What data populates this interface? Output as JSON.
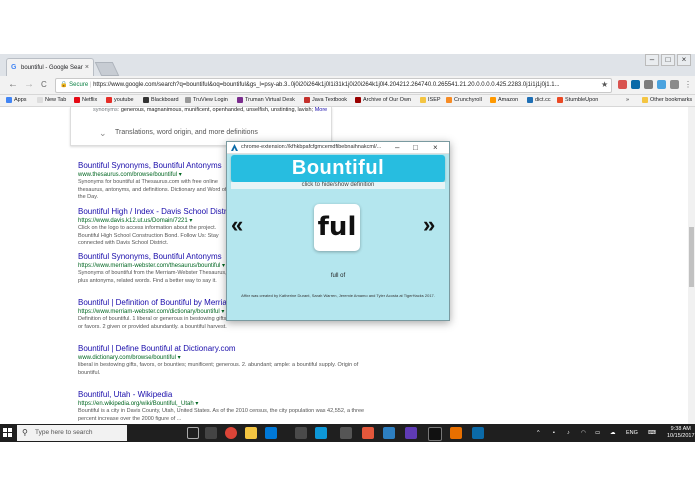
{
  "browser": {
    "tab_title": "bountiful - Google Sear",
    "tab_close": "×",
    "tab_favicon": "G",
    "nav_back": "←",
    "nav_forward": "→",
    "nav_reload": "C",
    "secure_label": "Secure",
    "url": "https://www.google.com/search?q=bountiful&oq=bountiful&gs_l=psy-ab.3..0j0i20i264k1j0l1i31k1j0i20i264k1j0l4.204212.264740.0.265541.21.20.0.0.0.0.425.2283.0j1i1j1j0j1.1...",
    "star": "★",
    "window_minimize": "–",
    "window_maximize": "□",
    "window_close": "×"
  },
  "bookmarks": {
    "items": [
      "Apps",
      "New Tab",
      "Netflix",
      "youtube",
      "Blackboard",
      "TruView Login",
      "Truman Virtual Desk",
      "Java Textbook",
      "Archive of Our Own",
      "ISEP",
      "Crunchyroll",
      "Amazon",
      "dict.cc",
      "StumbleUpon"
    ],
    "overflow": "»",
    "other": "Other bookmarks"
  },
  "knowledge_panel": {
    "synonyms_prefix": "synonyms:",
    "synonyms": "generous, magnanimous, munificent, openhanded, unselfish, unstinting, lavish;",
    "more": "More",
    "expand_icon": "⌄",
    "translations": "Translations, word origin, and more definitions"
  },
  "results": [
    {
      "title": "Bountiful Synonyms, Bountiful Antonyms",
      "url": "www.thesaurus.com/browse/bountiful ▾",
      "desc": "Synonyms for bountiful at Thesaurus.com with free online thesaurus, antonyms, and definitions. Dictionary and Word of the Day."
    },
    {
      "title": "Bountiful High / Index - Davis School District",
      "url": "https://www.davis.k12.ut.us/Domain/7221 ▾",
      "desc": "Click on the logo to access information about the project. Bountiful High School Construction Bond. Follow Us: Stay connected with Davis School District."
    },
    {
      "title": "Bountiful Synonyms, Bountiful Antonyms",
      "url": "https://www.merriam-webster.com/thesaurus/bountiful ▾",
      "desc": "Synonyms of bountiful from the Merriam-Webster Thesaurus, plus antonyms, related words. Find a better way to say it."
    },
    {
      "title": "Bountiful | Definition of Bountiful by Merriam-Webster",
      "url": "https://www.merriam-webster.com/dictionary/bountiful ▾",
      "desc": "Definition of bountiful. 1 liberal or generous in bestowing gifts or favors. 2 given or provided abundantly. a bountiful harvest."
    },
    {
      "title": "Bountiful | Define Bountiful at Dictionary.com",
      "url": "www.dictionary.com/browse/bountiful ▾",
      "desc": "liberal in bestowing gifts, favors, or bounties; munificent; generous. 2. abundant; ample: a bountiful supply. Origin of bountiful."
    },
    {
      "title": "Bountiful, Utah - Wikipedia",
      "url": "https://en.wikipedia.org/wiki/Bountiful,_Utah ▾",
      "desc": "Bountiful is a city in Davis County, Utah, United States. As of the 2010 census, the city population was 42,552, a three percent increase over the 2000 figure of ..."
    }
  ],
  "popup": {
    "window_title": "chrome-extension://kfhkbpafcfgmcemdfibebnaihnakcml/...",
    "minimize": "–",
    "maximize": "□",
    "close": "×",
    "app_name": "Bountiful",
    "hint": "click to hide/show definition",
    "prev": "«",
    "next": "»",
    "fragment": "ful",
    "definition": "full of",
    "credit": "Affixr was created by Katherine Durant, Sarah Warren, Jeremie Amamo and Tyler Acosta at TigerHacks 2017."
  },
  "taskbar": {
    "search_placeholder": "Type here to search",
    "search_icon": "⚲",
    "tray_chevron": "^",
    "language": "ENG",
    "time": "9:38 AM",
    "date": "10/15/2017"
  }
}
